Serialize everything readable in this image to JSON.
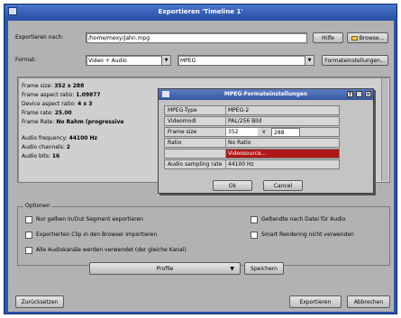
{
  "window": {
    "title": "Exportieren 'Timeline 1'"
  },
  "target": {
    "label": "Exportieren nach:",
    "value": "/home/mexy/Jahn.mpg",
    "help_label": "Hilfe",
    "browse_label": "Browse..."
  },
  "format": {
    "label": "Format:",
    "container_value": "Video + Audio",
    "codec_value": "MPEG",
    "settings_label": "Formateinstellungen..."
  },
  "info": {
    "lines": [
      {
        "k": "Frame size:",
        "v": "352 x 288"
      },
      {
        "k": "Frame aspect ratio:",
        "v": "1.09877"
      },
      {
        "k": "Device aspect ratio:",
        "v": "4 x 3"
      },
      {
        "k": "Frame rate:",
        "v": "25.00"
      },
      {
        "k": "Frame Rate:",
        "v": "No Rahm (progressive"
      },
      {
        "k": "Audio frequency:",
        "v": "44100 Hz"
      },
      {
        "k": "Audio channels:",
        "v": "2"
      },
      {
        "k": "Audio bits:",
        "v": "16"
      }
    ]
  },
  "dialog": {
    "title": "MPEG-Formateinstellungen",
    "rows": [
      {
        "k": "MPEG-Type",
        "v": "MPEG-2"
      },
      {
        "k": "Videomodi",
        "v": "PAL/256 Bild"
      },
      {
        "k": "Frame size",
        "v": "352",
        "v2": "288"
      },
      {
        "k": "Ratio",
        "v": "No Ratio"
      },
      {
        "k": "",
        "v": "Videosource..."
      },
      {
        "k": "Audio sampling rate",
        "v": "44100 Hz"
      }
    ],
    "ok_label": "Ok",
    "cancel_label": "Cancel"
  },
  "options": {
    "title": "Optionen",
    "items": [
      {
        "label": "Nur gelben In/Out Segment exportieren"
      },
      {
        "label": "Exportierten Clip in den Browser importieren"
      },
      {
        "label": "Alle Audiokanäle werden verwendet (der gleiche Kanal)"
      },
      {
        "label": "Geltendte nach Datei für Audio"
      },
      {
        "label": "Smart Rendering nicht verwenden"
      }
    ]
  },
  "preset": {
    "value": "Profile",
    "save_label": "Speichern"
  },
  "footer": {
    "reset_label": "Zurücksetzen",
    "export_label": "Exportieren",
    "cancel_label": "Abbrechen"
  }
}
